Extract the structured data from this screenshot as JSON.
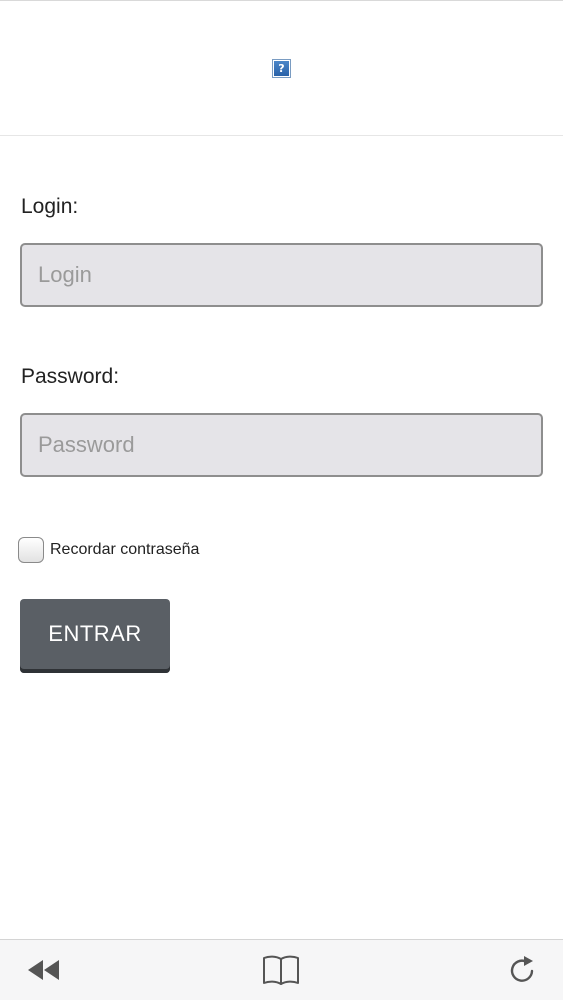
{
  "header": {
    "image_icon": "broken-image-icon",
    "image_glyph": "?"
  },
  "form": {
    "login_label": "Login:",
    "login_placeholder": "Login",
    "login_value": "",
    "password_label": "Password:",
    "password_placeholder": "Password",
    "password_value": "",
    "remember_label": "Recordar contraseña",
    "remember_checked": false,
    "submit_label": "ENTRAR"
  },
  "toolbar": {
    "back_icon": "rewind-icon",
    "bookmarks_icon": "book-icon",
    "reload_icon": "reload-icon"
  },
  "colors": {
    "button_bg": "#5a5f65",
    "field_bg": "#e5e4e8",
    "field_border": "#8e8e8e",
    "toolbar_bg": "#f6f6f7",
    "icon_color": "#555555"
  }
}
